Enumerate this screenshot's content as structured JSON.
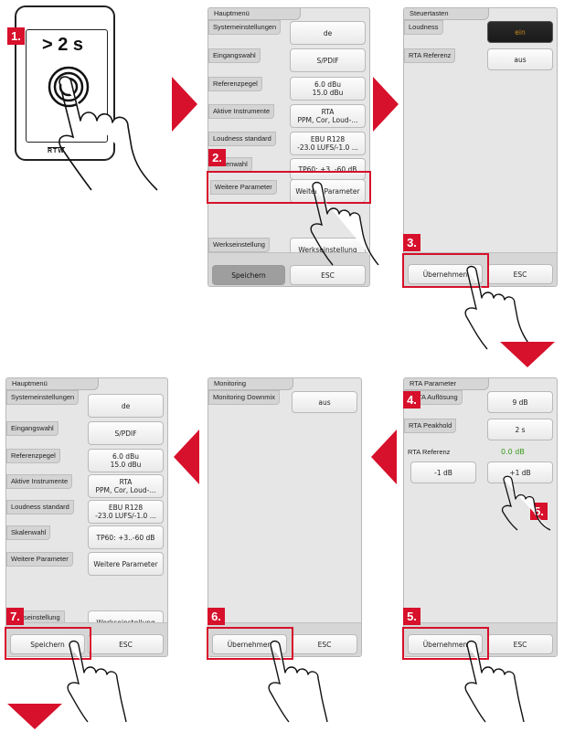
{
  "colors": {
    "accent": "#d7102b",
    "panel": "#e6e6e6",
    "active_text": "#c98a1a",
    "value_green": "#3a9a1a"
  },
  "steps": [
    "1.",
    "2.",
    "3.",
    "4.",
    "5.",
    "5.",
    "6.",
    "7."
  ],
  "device": {
    "gesture": "> 2 s",
    "brand": "RTW"
  },
  "panel1": {
    "title": "Hauptmenü",
    "rows": [
      {
        "label": "Systemeinstellungen",
        "value": "de"
      },
      {
        "label": "Eingangswahl",
        "value": "S/PDIF"
      },
      {
        "label": "Referenzpegel",
        "value": "6.0 dBu\n15.0 dBu"
      },
      {
        "label": "Aktive Instrumente",
        "value": "RTA\nPPM, Cor, Loud-..."
      },
      {
        "label": "Loudness standard",
        "value": "EBU R128\n-23.0 LUFS/-1.0 ..."
      },
      {
        "label": "enwahl",
        "value": "TP60: +3..-60 dB"
      },
      {
        "label": "Weitere Parameter",
        "value": "Weitere Parameter"
      }
    ],
    "factory": {
      "label": "Werkseinstellung",
      "value": "Werkseinstellung"
    },
    "save": "Speichern",
    "esc": "ESC"
  },
  "panel2": {
    "title": "Steuertasten",
    "rows": [
      {
        "label": "Loudness",
        "value": "ein"
      },
      {
        "label": "RTA Referenz",
        "value": "aus"
      }
    ],
    "apply": "Übernehmen",
    "esc": "ESC"
  },
  "panel3": {
    "title": "RTA Parameter",
    "rows": [
      {
        "label": "TA Auflösung",
        "value": "9 dB"
      },
      {
        "label": "RTA Peakhold",
        "value": "2 s"
      },
      {
        "label": "RTA Referenz",
        "value": "0.0 dB"
      }
    ],
    "minus": "-1 dB",
    "plus": "+1 dB",
    "apply": "Übernehmen",
    "esc": "ESC"
  },
  "panel4": {
    "title": "Monitoring",
    "rows": [
      {
        "label": "Monitoring Downmix",
        "value": "aus"
      }
    ],
    "apply": "Übernehmen",
    "esc": "ESC"
  },
  "panel5": {
    "title": "Hauptmenü",
    "rows": [
      {
        "label": "Systemeinstellungen",
        "value": "de"
      },
      {
        "label": "Eingangswahl",
        "value": "S/PDIF"
      },
      {
        "label": "Referenzpegel",
        "value": "6.0 dBu\n15.0 dBu"
      },
      {
        "label": "Aktive Instrumente",
        "value": "RTA\nPPM, Cor, Loud-..."
      },
      {
        "label": "Loudness standard",
        "value": "EBU R128\n-23.0 LUFS/-1.0 ..."
      },
      {
        "label": "Skalenwahl",
        "value": "TP60: +3..-60 dB"
      },
      {
        "label": "Weitere Parameter",
        "value": "Weitere Parameter"
      }
    ],
    "factory": {
      "label": "seinstellung",
      "value": "Werkseinstellung"
    },
    "save": "Speichern",
    "esc": "ESC"
  }
}
